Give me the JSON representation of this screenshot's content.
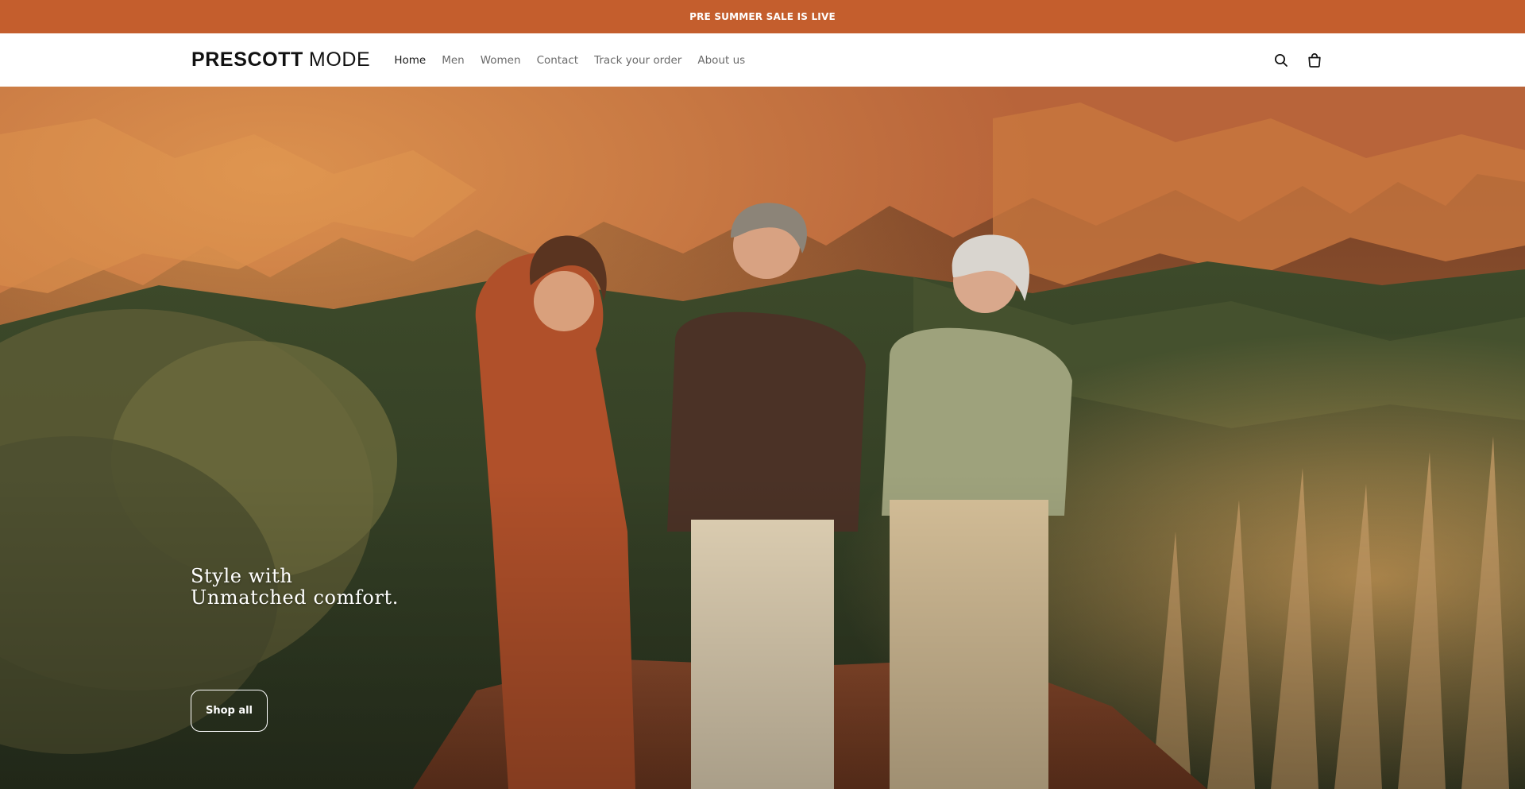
{
  "announcement": {
    "text": "PRE SUMMER SALE IS LIVE",
    "background": "#c45e2d"
  },
  "header": {
    "logo": {
      "bold": "PRESCOTT",
      "light": "MODE"
    },
    "nav": [
      {
        "label": "Home",
        "active": true
      },
      {
        "label": "Men",
        "active": false
      },
      {
        "label": "Women",
        "active": false
      },
      {
        "label": "Contact",
        "active": false
      },
      {
        "label": "Track your order",
        "active": false
      },
      {
        "label": "About us",
        "active": false
      }
    ],
    "icons": [
      "search-icon",
      "shopping-bag-icon"
    ]
  },
  "hero": {
    "heading_line1": "Style with",
    "heading_line2": "Unmatched comfort.",
    "cta_label": "Shop all",
    "image_subject": "three models walking on a red-rock desert trail"
  }
}
